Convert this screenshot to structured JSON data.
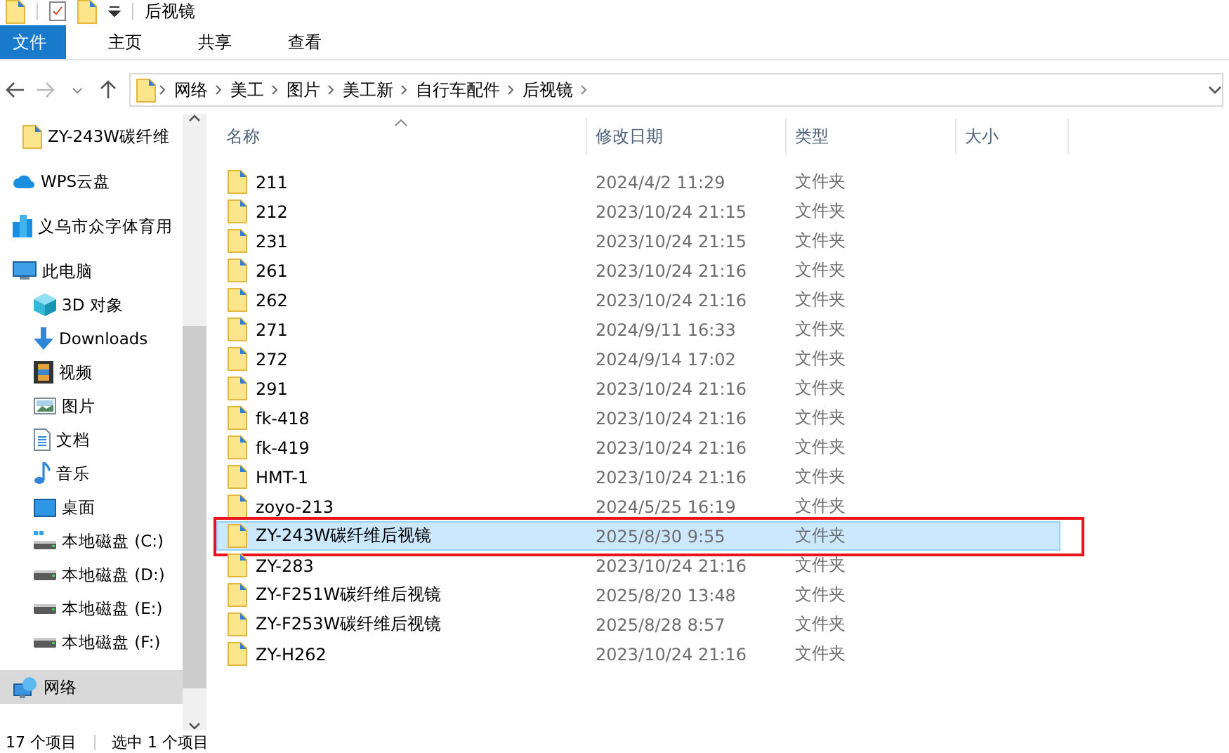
{
  "window": {
    "title": "后视镜"
  },
  "ribbon": {
    "tabs": [
      {
        "label": "文件",
        "kind": "file",
        "selected": false
      },
      {
        "label": "主页",
        "kind": "tab",
        "selected": false
      },
      {
        "label": "共享",
        "kind": "tab",
        "selected": false
      },
      {
        "label": "查看",
        "kind": "tab",
        "selected": false
      }
    ]
  },
  "address_bar": {
    "path": [
      "网络",
      "美工",
      "图片",
      "美工新",
      "自行车配件",
      "后视镜"
    ]
  },
  "sidebar": {
    "items": [
      {
        "label": "ZY-243W碳纤维",
        "kind": "folder",
        "selected": false
      },
      {
        "label": "WPS云盘",
        "kind": "cloud",
        "selected": false
      },
      {
        "label": "义乌市众字体育用",
        "kind": "team",
        "selected": false
      },
      {
        "label": "此电脑",
        "kind": "pc",
        "selected": false,
        "children": [
          {
            "label": "3D 对象",
            "kind": "cube",
            "selected": false
          },
          {
            "label": "Downloads",
            "kind": "download",
            "selected": false
          },
          {
            "label": "视频",
            "kind": "video",
            "selected": false
          },
          {
            "label": "图片",
            "kind": "picture",
            "selected": false
          },
          {
            "label": "文档",
            "kind": "doc",
            "selected": false
          },
          {
            "label": "音乐",
            "kind": "music",
            "selected": false
          },
          {
            "label": "桌面",
            "kind": "desktop",
            "selected": false
          },
          {
            "label": "本地磁盘 (C:)",
            "kind": "sysdrive",
            "selected": false
          },
          {
            "label": "本地磁盘 (D:)",
            "kind": "drive",
            "selected": false
          },
          {
            "label": "本地磁盘 (E:)",
            "kind": "drive",
            "selected": false
          },
          {
            "label": "本地磁盘 (F:)",
            "kind": "drive",
            "selected": false
          }
        ]
      },
      {
        "label": "网络",
        "kind": "network",
        "selected": true
      }
    ]
  },
  "table": {
    "columns": [
      {
        "label": "名称",
        "sorted": true
      },
      {
        "label": "修改日期",
        "sorted": false
      },
      {
        "label": "类型",
        "sorted": false
      },
      {
        "label": "大小",
        "sorted": false
      }
    ],
    "rows": [
      {
        "name": "211",
        "date": "2024/4/2 11:29",
        "type": "文件夹",
        "selected": false,
        "highlighted": false
      },
      {
        "name": "212",
        "date": "2023/10/24 21:15",
        "type": "文件夹",
        "selected": false,
        "highlighted": false
      },
      {
        "name": "231",
        "date": "2023/10/24 21:15",
        "type": "文件夹",
        "selected": false,
        "highlighted": false
      },
      {
        "name": "261",
        "date": "2023/10/24 21:16",
        "type": "文件夹",
        "selected": false,
        "highlighted": false
      },
      {
        "name": "262",
        "date": "2023/10/24 21:16",
        "type": "文件夹",
        "selected": false,
        "highlighted": false
      },
      {
        "name": "271",
        "date": "2024/9/11 16:33",
        "type": "文件夹",
        "selected": false,
        "highlighted": false
      },
      {
        "name": "272",
        "date": "2024/9/14 17:02",
        "type": "文件夹",
        "selected": false,
        "highlighted": false
      },
      {
        "name": "291",
        "date": "2023/10/24 21:16",
        "type": "文件夹",
        "selected": false,
        "highlighted": false
      },
      {
        "name": "fk-418",
        "date": "2023/10/24 21:16",
        "type": "文件夹",
        "selected": false,
        "highlighted": false
      },
      {
        "name": "fk-419",
        "date": "2023/10/24 21:16",
        "type": "文件夹",
        "selected": false,
        "highlighted": false
      },
      {
        "name": "HMT-1",
        "date": "2023/10/24 21:16",
        "type": "文件夹",
        "selected": false,
        "highlighted": false
      },
      {
        "name": "zoyo-213",
        "date": "2024/5/25 16:19",
        "type": "文件夹",
        "selected": false,
        "highlighted": false
      },
      {
        "name": "ZY-243W碳纤维后视镜",
        "date": "2025/8/30 9:55",
        "type": "文件夹",
        "selected": true,
        "highlighted": true
      },
      {
        "name": "ZY-283",
        "date": "2023/10/24 21:16",
        "type": "文件夹",
        "selected": false,
        "highlighted": false
      },
      {
        "name": "ZY-F251W碳纤维后视镜",
        "date": "2025/8/20 13:48",
        "type": "文件夹",
        "selected": false,
        "highlighted": false
      },
      {
        "name": "ZY-F253W碳纤维后视镜",
        "date": "2025/8/28 8:57",
        "type": "文件夹",
        "selected": false,
        "highlighted": false
      },
      {
        "name": "ZY-H262",
        "date": "2023/10/24 21:16",
        "type": "文件夹",
        "selected": false,
        "highlighted": false
      }
    ]
  },
  "status_bar": {
    "item_count": "17 个项目",
    "selection": "选中 1 个项目"
  }
}
